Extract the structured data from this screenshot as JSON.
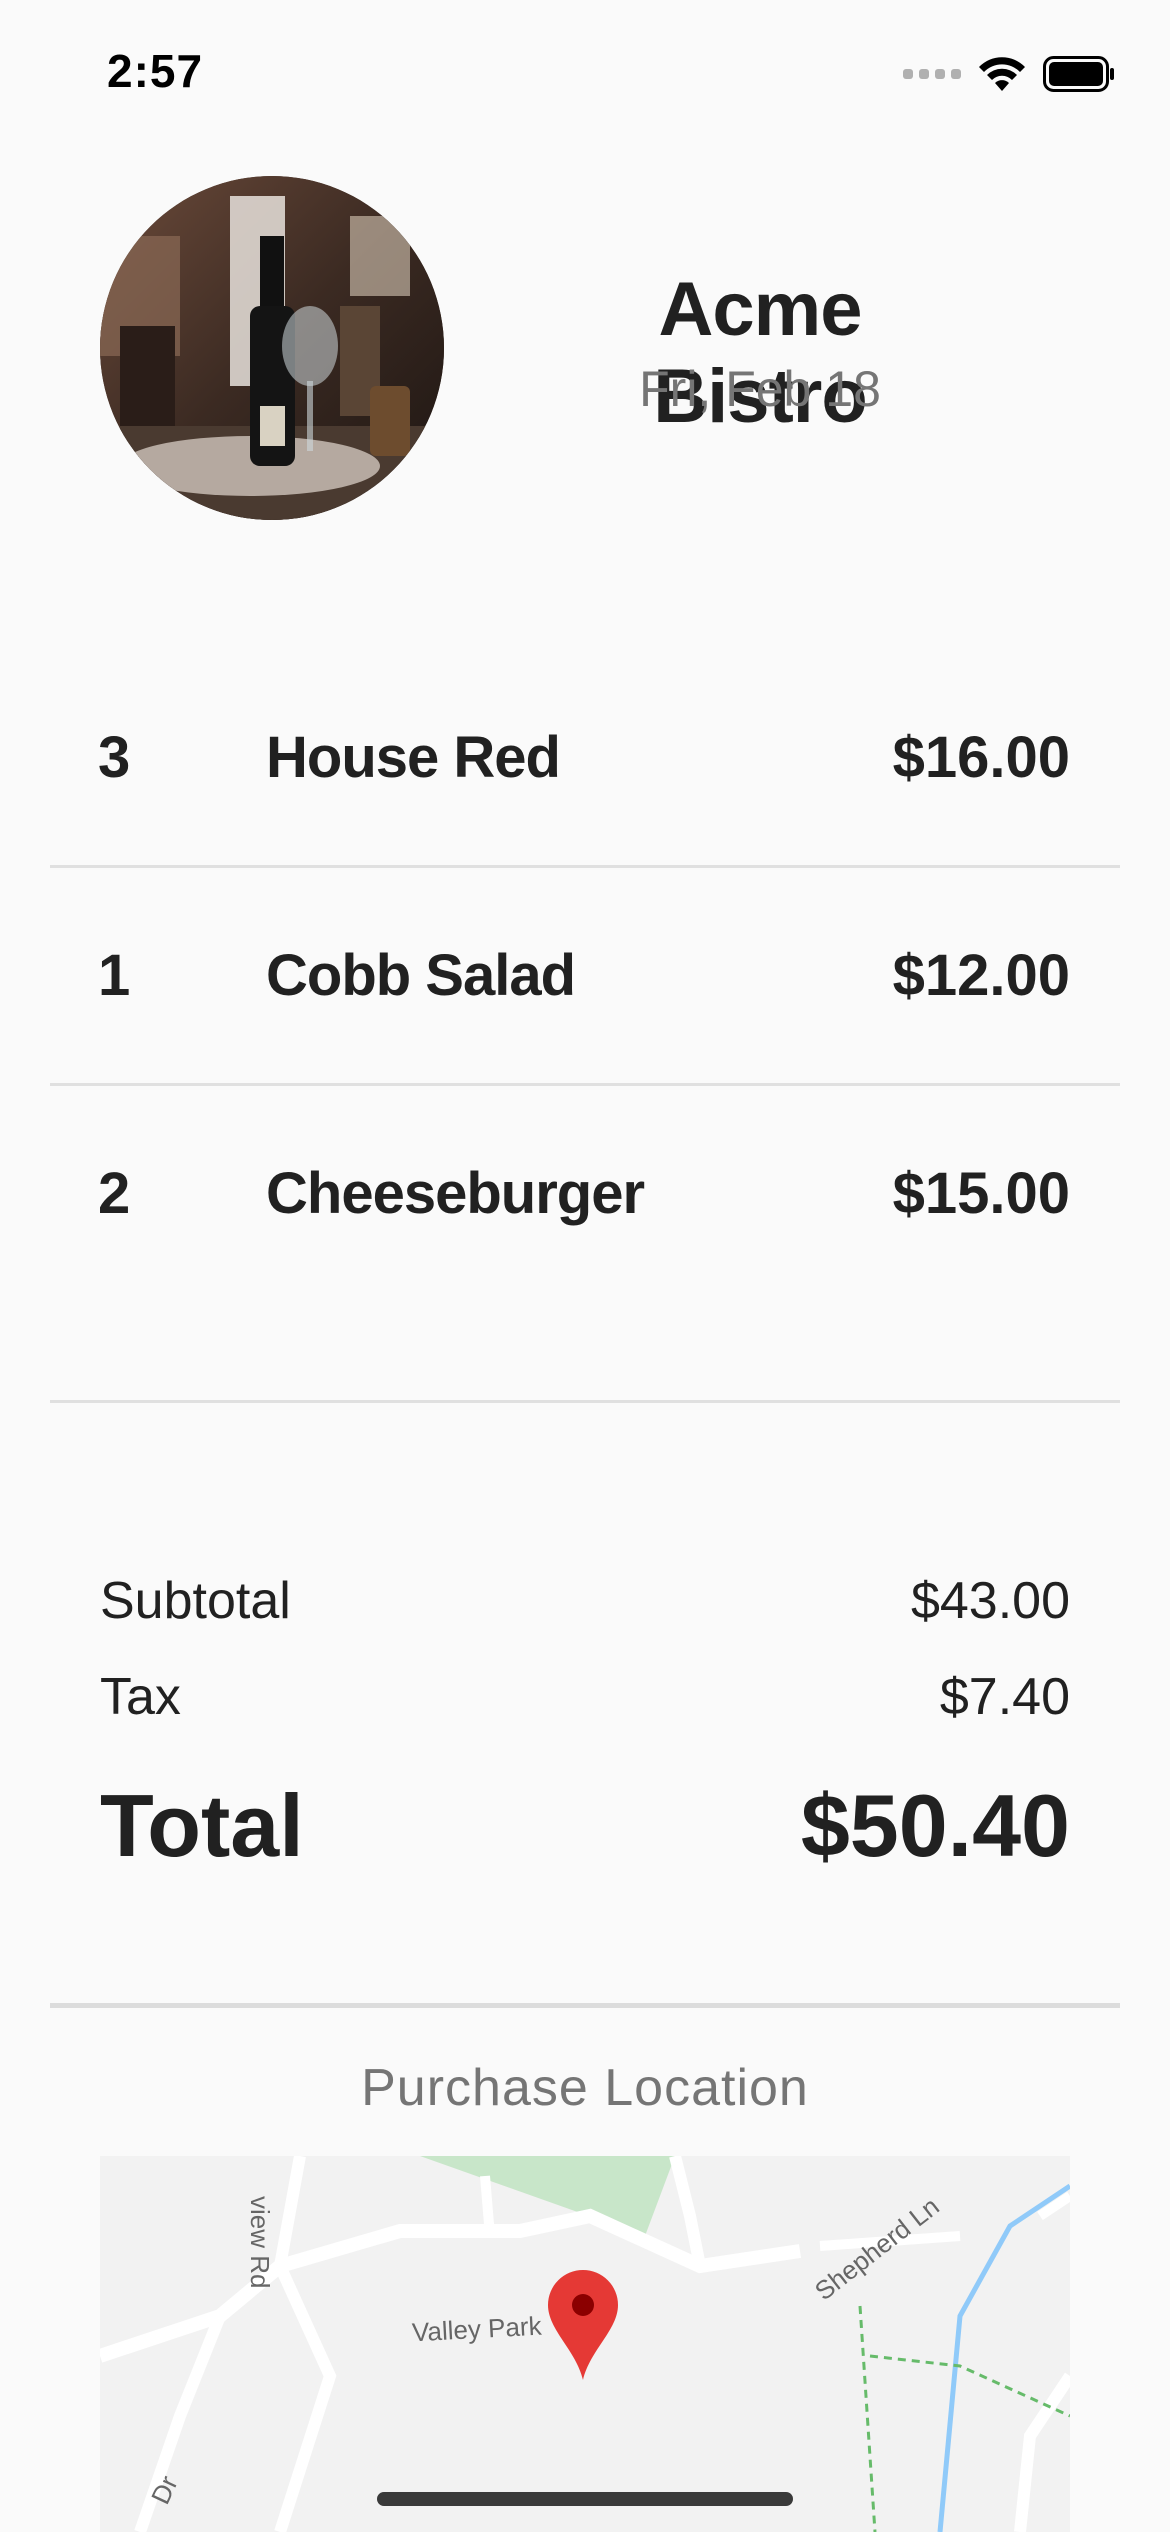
{
  "status_bar": {
    "time": "2:57"
  },
  "merchant": {
    "name": "Acme Bistro",
    "date": "Fri, Feb 18"
  },
  "items": [
    {
      "qty": "3",
      "name": "House Red",
      "price": "$16.00"
    },
    {
      "qty": "1",
      "name": "Cobb Salad",
      "price": "$12.00"
    },
    {
      "qty": "2",
      "name": "Cheeseburger",
      "price": "$15.00"
    }
  ],
  "totals": {
    "subtotal_label": "Subtotal",
    "subtotal_value": "$43.00",
    "tax_label": "Tax",
    "tax_value": "$7.40",
    "total_label": "Total",
    "total_value": "$50.40"
  },
  "location": {
    "title": "Purchase Location",
    "map_labels": {
      "road1": "view Rd",
      "road2": "Valley Park",
      "road3": "Shepherd Ln",
      "road4": "Dr"
    }
  },
  "colors": {
    "pin": "#e53935",
    "park": "#c8e6c9",
    "water": "#90caf9"
  }
}
